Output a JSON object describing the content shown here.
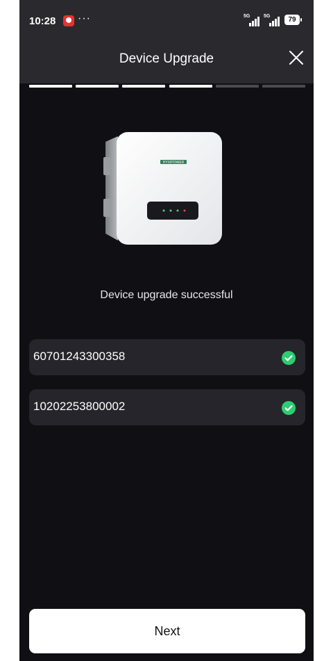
{
  "status_bar": {
    "time": "10:28",
    "more": "···",
    "signal_labels": [
      "5G",
      "5G"
    ],
    "battery": "79",
    "notification_icon": "red-notification-icon"
  },
  "header": {
    "title": "Device Upgrade",
    "close_icon": "close-icon"
  },
  "progress": {
    "total_steps": 6,
    "completed_steps": 4
  },
  "device": {
    "image": "inverter-device-image",
    "logo": "HYXIPOWER"
  },
  "message": "Device upgrade successful",
  "devices": [
    {
      "serial": "60701243300358",
      "status_icon": "check-circle-icon"
    },
    {
      "serial": "10202253800002",
      "status_icon": "check-circle-icon"
    }
  ],
  "next_button": {
    "label": "Next"
  },
  "colors": {
    "background": "#0f0f14",
    "header": "#2a2a2e",
    "row": "#25252b",
    "success": "#2ecc71",
    "progress_done": "#ffffff",
    "progress_pending": "#4a4a50"
  }
}
